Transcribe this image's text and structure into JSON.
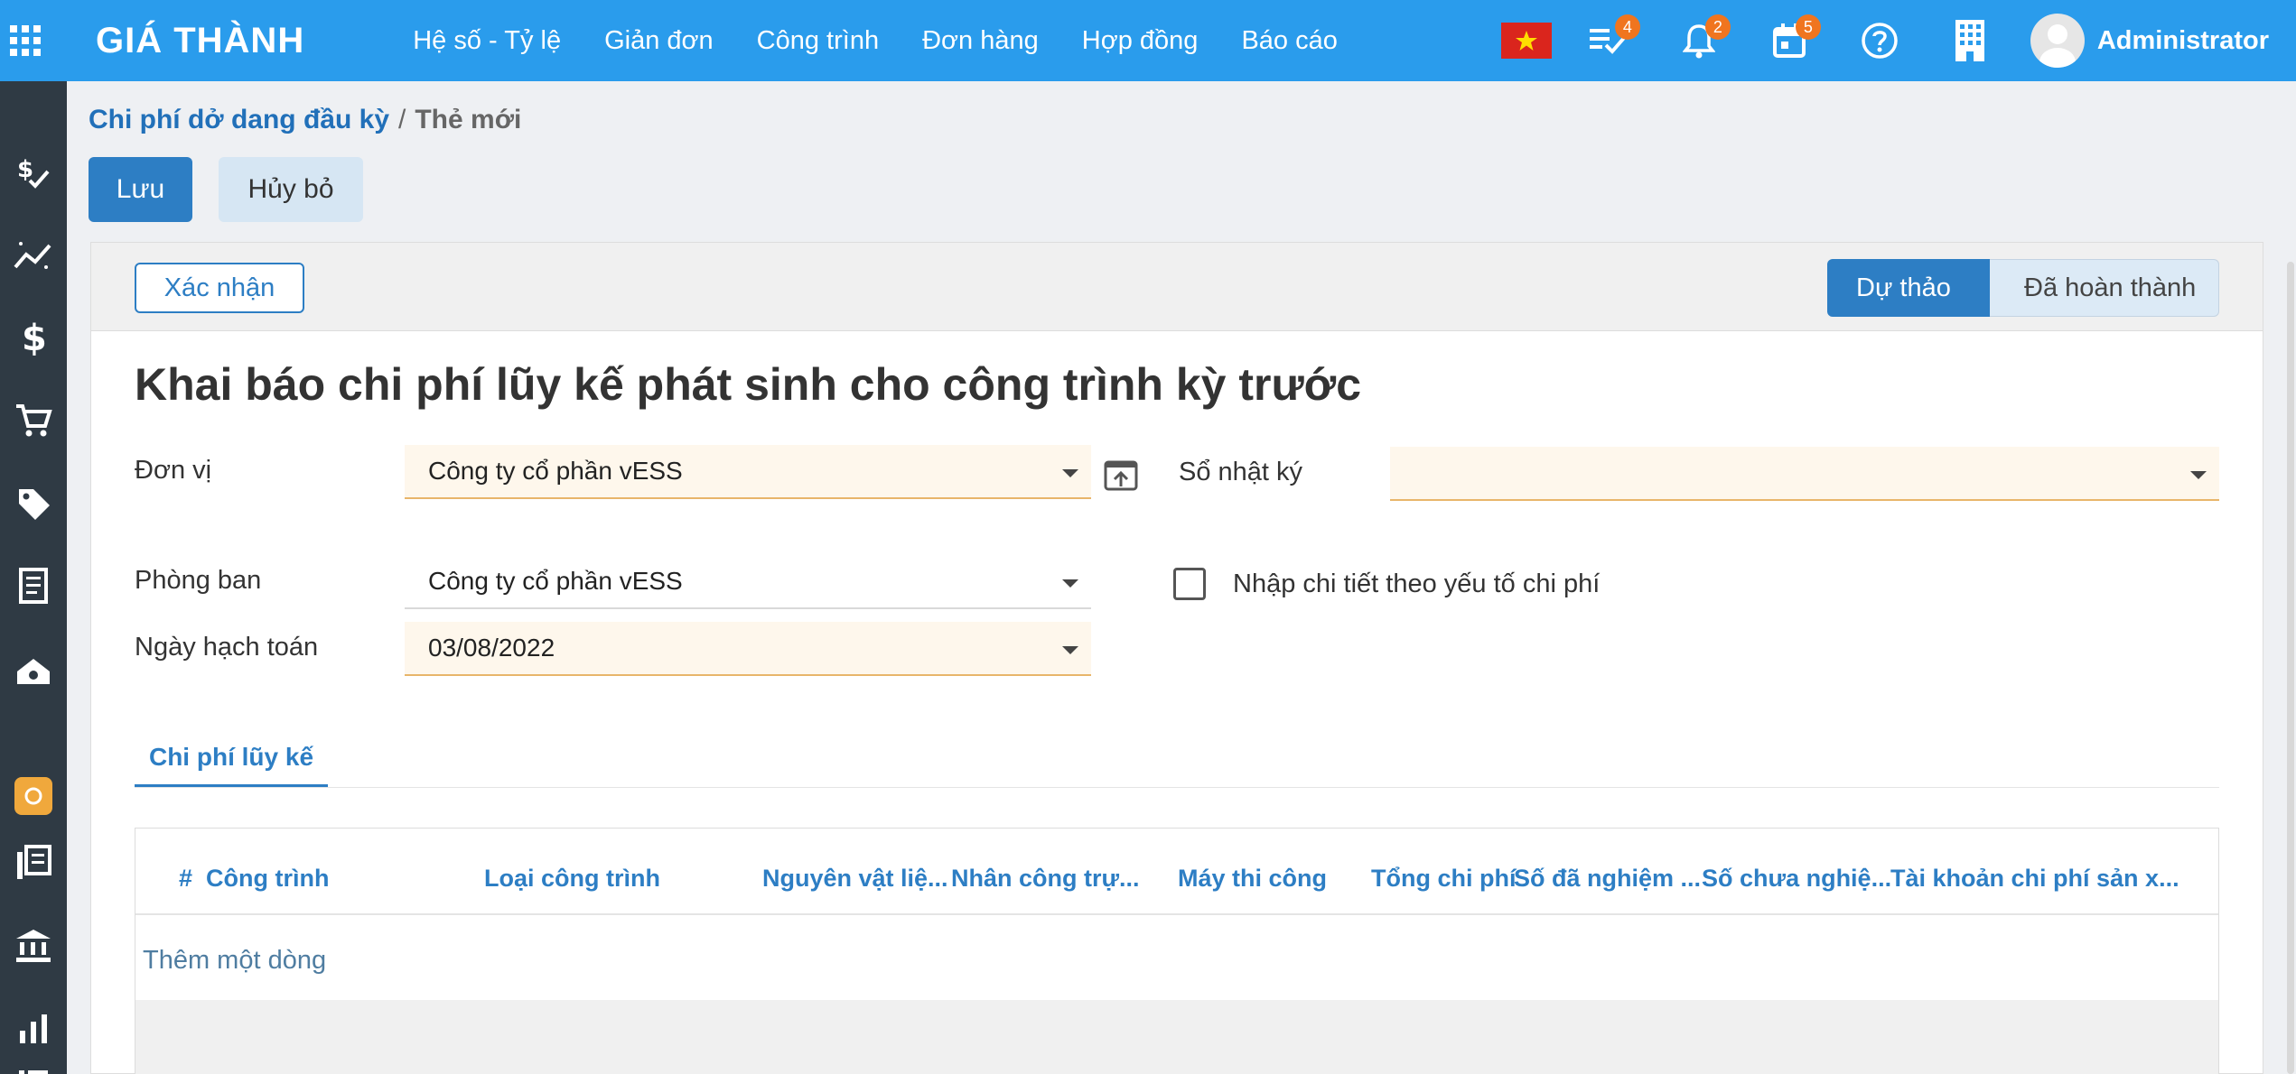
{
  "navbar": {
    "brand": "GIÁ THÀNH",
    "menu": [
      "Hệ số - Tỷ lệ",
      "Giản đơn",
      "Công trình",
      "Đơn hàng",
      "Hợp đồng",
      "Báo cáo"
    ],
    "badges": {
      "activities": "4",
      "notifications": "2",
      "calendar": "5"
    },
    "user": "Administrator"
  },
  "breadcrumb": {
    "parent": "Chi phí dở dang đầu kỳ",
    "separator": "/",
    "current": "Thẻ mới"
  },
  "actions": {
    "save": "Lưu",
    "discard": "Hủy bỏ"
  },
  "statusbar": {
    "confirm": "Xác nhận",
    "stages": [
      "Dự thảo",
      "Đã hoàn thành"
    ]
  },
  "form": {
    "title": "Khai báo chi phí lũy kế phát sinh cho công trình kỳ trước",
    "company_label": "Đơn vị",
    "company_value": "Công ty cổ phần vESS",
    "department_label": "Phòng ban",
    "department_value": "Công ty cổ phần vESS",
    "date_label": "Ngày hạch toán",
    "date_value": "03/08/2022",
    "journal_label": "Sổ nhật ký",
    "journal_value": "",
    "detail_checkbox_label": "Nhập chi tiết theo yếu tố chi phí",
    "detail_checked": false
  },
  "tabs": [
    "Chi phí lũy kế"
  ],
  "table": {
    "columns": [
      "#",
      "Công trình",
      "Loại công trình",
      "Nguyên vật liệ...",
      "Nhân công trự...",
      "Máy thi công",
      "Tổng chi phí",
      "Số đã nghiệm ...",
      "Số chưa nghiệ...",
      "Tài khoản chi phí sản x..."
    ],
    "add_line": "Thêm một dòng"
  },
  "colors": {
    "navbar": "#2a9cec",
    "sidebar": "#2f3a44",
    "primary": "#2d7ec4",
    "badge": "#f0751f"
  }
}
